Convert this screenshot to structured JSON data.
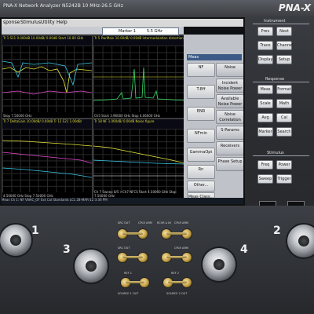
{
  "header": {
    "model": "PNA-X Network Analyzer   N5242B   10 MHz-26.5 GHz",
    "brand": "PNA-X"
  },
  "menubar": [
    "sponse",
    "Stimulus",
    "Utility",
    "Help"
  ],
  "marker_box": {
    "label": "Marker 1",
    "value": "5.5 GHz"
  },
  "traces": {
    "w1": {
      "header": "Tr 1  S11 0.000dB  10.00dB/  0.00dB\nStart 10.00 GHz",
      "footer": "Stop 7.50000 GHz"
    },
    "w2": {
      "header": "Tr 5  PwrMain  10.00dB/  0.00dB\nIntermodulation distortion",
      "footer": "Ch5 Start 3.96000 GHz  Stop 4.06000 GHz"
    },
    "w3": {
      "header": "Tr 7  DeltaGain 10.00dB/  0.00dB\nTr 12  S21 1.00dB/",
      "footer": "4.50000 GHz   Stop 7.50000 GHz"
    },
    "w4": {
      "header": "Tr 18  NF 1.000dB/  0.00dB\nNoise figure",
      "footer": "Ch 7 Sweep 8/5   >Ch7  NFCS  Start 4.50000 GHz  Stop 7.50000 GHz"
    }
  },
  "softkeys": {
    "title": "Meas",
    "left": [
      "NF",
      "T-Eff",
      "ENR",
      "NFmin",
      "GammaOpt",
      "Rn",
      "Other...",
      "Meas Class..."
    ],
    "right": [
      "Noise",
      "Incident Noise Power",
      "Available Noise Power",
      "Noise Correlation",
      "S-Params",
      "Receivers",
      "Phase Setup"
    ]
  },
  "statusbar": "Meas   Ch 1: NF   VNAC_OF   Ext Cal   Standards          LCL   28-MAR-12  3:36 PM",
  "instrument": {
    "label": "Instrument",
    "keys": [
      "Prev",
      "Next",
      "Trace",
      "Channel",
      "Display",
      "Setup"
    ]
  },
  "response": {
    "label": "Response",
    "keys": [
      "Meas",
      "Format",
      "Scale",
      "Math",
      "Avg BW",
      "Cal",
      "Marker",
      "Search"
    ]
  },
  "stimulus": {
    "label": "Stimulus",
    "keys": [
      "Freq",
      "Power",
      "Sweep",
      "Trigger"
    ]
  },
  "ports": {
    "port1": "1",
    "port2": "2",
    "port3": "3",
    "port4": "4"
  },
  "jumpers": {
    "labels": [
      "SRC OUT",
      "CPLR ARM",
      "RCVR A IN",
      "CPLR ARM",
      "SRC OUT",
      "CPLR ARM",
      "REF 1",
      "REF 2",
      "SOURCE 1 OUT",
      "SOURCE 2 OUT"
    ]
  }
}
